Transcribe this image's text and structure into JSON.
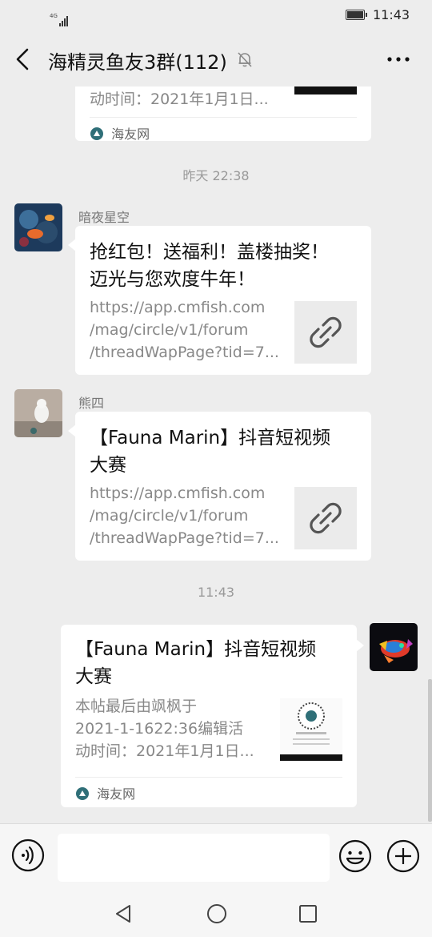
{
  "status_bar": {
    "network": "4G",
    "time": "11:43"
  },
  "header": {
    "title": "海精灵鱼友3群(112)"
  },
  "messages": [
    {
      "kind": "link_card_partial",
      "desc_line": "动时间：2021年1月1日...",
      "source": "海友网"
    },
    {
      "kind": "timestamp",
      "text": "昨天 22:38"
    },
    {
      "kind": "link_card",
      "sender": "暗夜星空",
      "title_lines": [
        "抢红包！送福利！盖楼抽奖！",
        "迈光与您欢度牛年！"
      ],
      "desc_lines": [
        "https://app.cmfish.com",
        "/mag/circle/v1/forum",
        "/threadWapPage?tid=7..."
      ]
    },
    {
      "kind": "link_card",
      "sender": "熊四",
      "title_lines": [
        "【Fauna Marin】抖音短视频",
        "大赛"
      ],
      "desc_lines": [
        "https://app.cmfish.com",
        "/mag/circle/v1/forum",
        "/threadWapPage?tid=7..."
      ]
    },
    {
      "kind": "timestamp",
      "text": "11:43"
    },
    {
      "kind": "link_card_self",
      "title_lines": [
        "【Fauna Marin】抖音短视频",
        "大赛"
      ],
      "desc_lines": [
        "本帖最后由飒枫于",
        "2021-1-1622:36编辑活",
        "动时间：2021年1月1日..."
      ],
      "source": "海友网"
    }
  ]
}
